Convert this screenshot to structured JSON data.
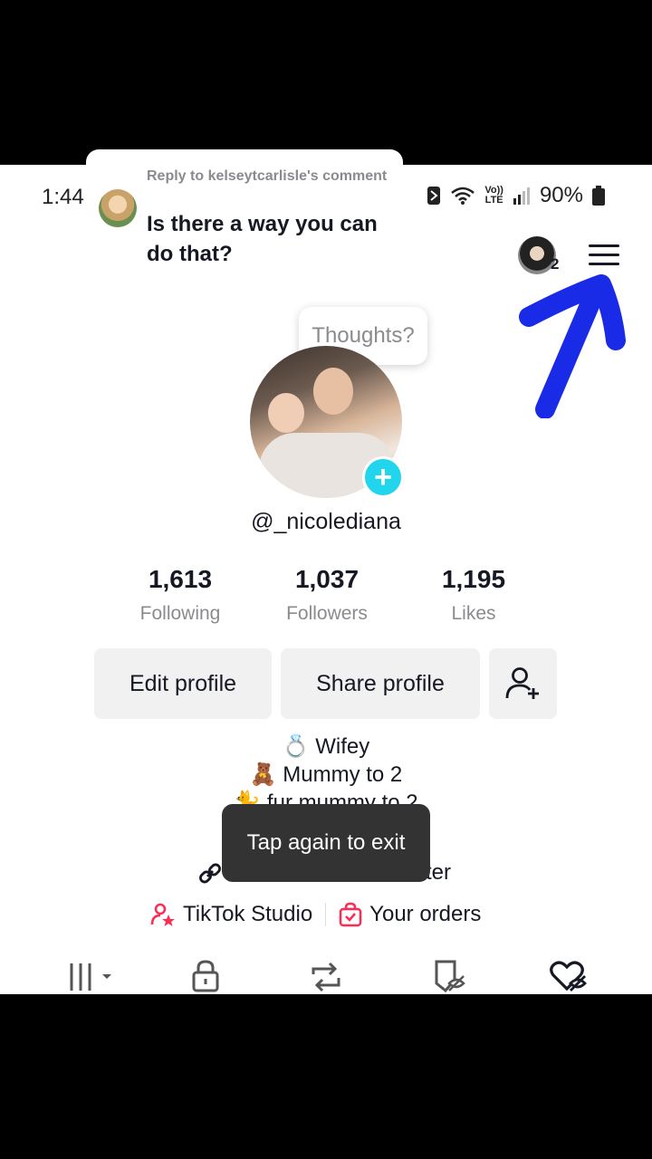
{
  "status_bar": {
    "time": "1:44",
    "network_top": "Vo))",
    "network_bottom": "LTE",
    "battery": "90%"
  },
  "reply": {
    "meta": "Reply to kelseytcarlisle's comment",
    "text": "Is there a way you can do that?"
  },
  "header": {
    "account_count": "2"
  },
  "profile": {
    "thought_bubble": "Thoughts?",
    "username": "@_nicolediana",
    "stats": [
      {
        "value": "1,613",
        "label": "Following"
      },
      {
        "value": "1,037",
        "label": "Followers"
      },
      {
        "value": "1,195",
        "label": "Likes"
      }
    ],
    "edit_label": "Edit profile",
    "share_label": "Share profile"
  },
  "bio": {
    "line1": "💍 Wifey",
    "line2": "🧸 Mummy to 2",
    "line3": "🐈 fur mummy to 2",
    "link_fragment": "ter"
  },
  "toast": "Tap again to exit",
  "shortcuts": {
    "studio": "TikTok Studio",
    "orders": "Your orders"
  },
  "colors": {
    "accent_cyan": "#20d5ec",
    "annotation_arrow": "#1a2be8",
    "tiktok_red": "#fe2c55"
  }
}
